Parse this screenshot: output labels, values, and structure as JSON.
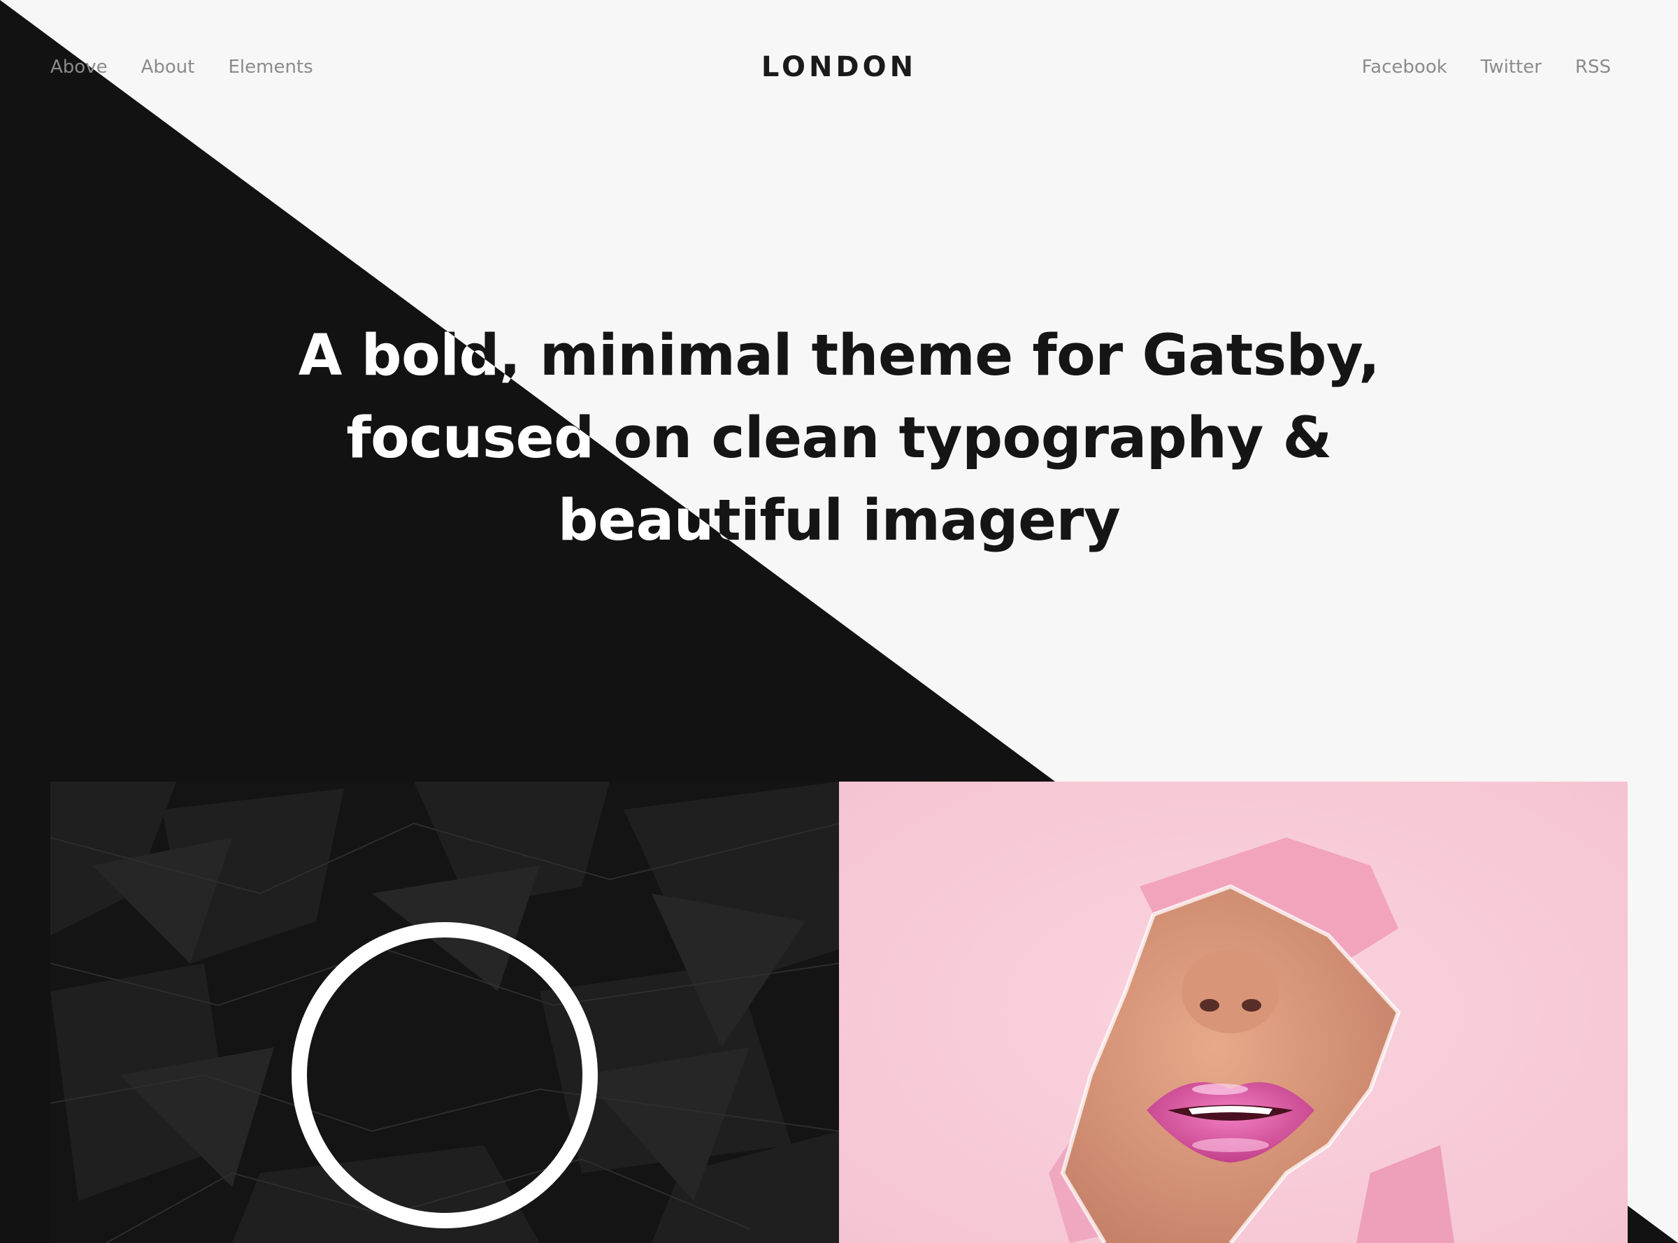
{
  "nav": {
    "left_items": [
      {
        "label": "Above"
      },
      {
        "label": "About"
      },
      {
        "label": "Elements"
      }
    ],
    "brand": "LONDON",
    "right_items": [
      {
        "label": "Facebook"
      },
      {
        "label": "Twitter"
      },
      {
        "label": "RSS"
      }
    ]
  },
  "hero": {
    "lines": [
      "A bold, minimal theme for Gatsby,",
      "focused on clean typography &",
      "beautiful imagery"
    ]
  },
  "gallery": {
    "tiles": [
      {
        "name": "dark-leaves-ring-image"
      },
      {
        "name": "pink-torn-paper-lips-image"
      }
    ]
  },
  "colors": {
    "background": "#f7f7f7",
    "dark": "#121212",
    "nav_text": "#8b8b8b",
    "pink": "#f8cbd8",
    "lips": "#e0589e"
  }
}
